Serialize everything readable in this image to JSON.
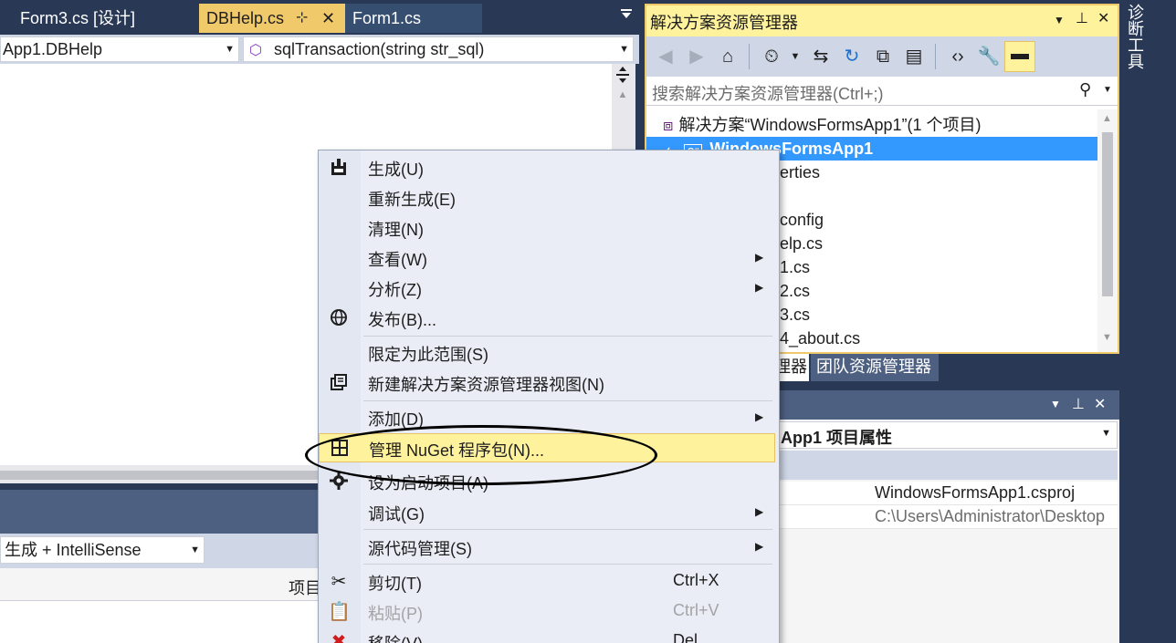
{
  "editor_tabs": [
    {
      "label": "Form3.cs [设计]",
      "state": "inactive"
    },
    {
      "label": "DBHelp.cs",
      "state": "active",
      "pin": "⊹",
      "close": "✕"
    },
    {
      "label": "Form1.cs",
      "state": "hover"
    }
  ],
  "navbar": {
    "type_combo": "App1.DBHelp",
    "member_combo": "sqlTransaction(string str_sql)"
  },
  "bottom_panel": {
    "build_filter": "生成 + IntelliSense",
    "column_project": "项目"
  },
  "solution_explorer": {
    "title": "解决方案资源管理器",
    "search_placeholder": "搜索解决方案资源管理器(Ctrl+;)",
    "tree": [
      {
        "label": "解决方案“WindowsFormsApp1”(1 个项目)",
        "selected": false
      },
      {
        "label": "WindowsFormsApp1",
        "selected": true
      },
      {
        "label": "erties",
        "selected": false
      },
      {
        "label": "",
        "selected": false
      },
      {
        "label": "config",
        "selected": false
      },
      {
        "label": "elp.cs",
        "selected": false
      },
      {
        "label": "1.cs",
        "selected": false
      },
      {
        "label": "2.cs",
        "selected": false
      },
      {
        "label": "3.cs",
        "selected": false
      },
      {
        "label": "4_about.cs",
        "selected": false
      }
    ],
    "tabs": [
      "理器",
      "团队资源管理器"
    ]
  },
  "properties": {
    "object": "App1 项目属性",
    "rows": [
      {
        "value": "WindowsFormsApp1.csproj",
        "muted": false
      },
      {
        "value": "C:\\Users\\Administrator\\Desktop",
        "muted": true
      }
    ]
  },
  "side_strip": {
    "label": "诊断工具"
  },
  "context_menu": {
    "items": [
      {
        "icon": "build-icon",
        "label": "生成(U)",
        "shortcut": "",
        "submenu": false,
        "disabled": false
      },
      {
        "icon": "",
        "label": "重新生成(E)",
        "shortcut": "",
        "submenu": false,
        "disabled": false
      },
      {
        "icon": "",
        "label": "清理(N)",
        "shortcut": "",
        "submenu": false,
        "disabled": false
      },
      {
        "icon": "",
        "label": "查看(W)",
        "shortcut": "",
        "submenu": true,
        "disabled": false
      },
      {
        "icon": "",
        "label": "分析(Z)",
        "shortcut": "",
        "submenu": true,
        "disabled": false
      },
      {
        "icon": "globe-icon",
        "label": "发布(B)...",
        "shortcut": "",
        "submenu": false,
        "disabled": false
      },
      {
        "icon": "",
        "label": "限定为此范围(S)",
        "shortcut": "",
        "submenu": false,
        "disabled": false
      },
      {
        "icon": "new-view-icon",
        "label": "新建解决方案资源管理器视图(N)",
        "shortcut": "",
        "submenu": false,
        "disabled": false
      },
      {
        "icon": "",
        "label": "添加(D)",
        "shortcut": "",
        "submenu": true,
        "disabled": false
      },
      {
        "icon": "nuget-icon",
        "label": "管理 NuGet 程序包(N)...",
        "shortcut": "",
        "submenu": false,
        "disabled": false,
        "highlighted": true
      },
      {
        "icon": "gear-icon",
        "label": "设为启动项目(A)",
        "shortcut": "",
        "submenu": false,
        "disabled": false
      },
      {
        "icon": "",
        "label": "调试(G)",
        "shortcut": "",
        "submenu": true,
        "disabled": false
      },
      {
        "icon": "",
        "label": "源代码管理(S)",
        "shortcut": "",
        "submenu": true,
        "disabled": false
      },
      {
        "icon": "scissors-icon",
        "label": "剪切(T)",
        "shortcut": "Ctrl+X",
        "submenu": false,
        "disabled": false
      },
      {
        "icon": "paste-icon",
        "label": "粘贴(P)",
        "shortcut": "Ctrl+V",
        "submenu": false,
        "disabled": true
      },
      {
        "icon": "remove-icon",
        "label": "移除(V)",
        "shortcut": "Del",
        "submenu": false,
        "disabled": false
      }
    ]
  },
  "colors": {
    "chrome_dark": "#293955",
    "active_tab": "#f0c96b",
    "menu_highlight": "#fff29d",
    "selection": "#3399ff"
  }
}
